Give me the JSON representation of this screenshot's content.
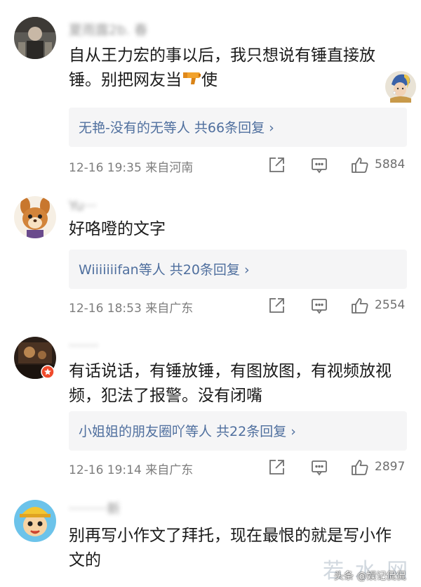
{
  "comments": [
    {
      "username": "夏雨露2b. 春",
      "text_before_emoji": "自从王力宏的事以后，我只想说有锤直接放锤。别把网友当",
      "text_after_emoji": "使",
      "emoji": "pistol-icon",
      "sticker": "girl-with-pearl-earring-sticker",
      "reply_summary": "无艳-没有的无等人 共66条回复 ›",
      "time": "12-16 19:35 来自河南",
      "likes": "5884"
    },
    {
      "username": "Yu···",
      "text": "好咯噔的文字",
      "reply_summary": "Wiiiiiiifan等人 共20条回复 ›",
      "time": "12-16 18:53 来自广东",
      "likes": "2554"
    },
    {
      "username": "·······",
      "text": "有话说话，有锤放锤，有图放图，有视频放视频，犯法了报警。没有闭嘴",
      "reply_summary": "小姐姐的朋友圈吖等人 共22条回复 ›",
      "time": "12-16 19:14 来自广东",
      "likes": "2897"
    },
    {
      "username": "·········新",
      "text": "别再写小作文了拜托，现在最恨的就是写小作文的"
    }
  ],
  "watermark": {
    "big": "若 水 网",
    "small": "头条 @娱记侃侃"
  },
  "colors": {
    "reply_link": "#4f6f9e",
    "reply_bg": "#f5f5f6",
    "meta_text": "#7d7d7d"
  }
}
